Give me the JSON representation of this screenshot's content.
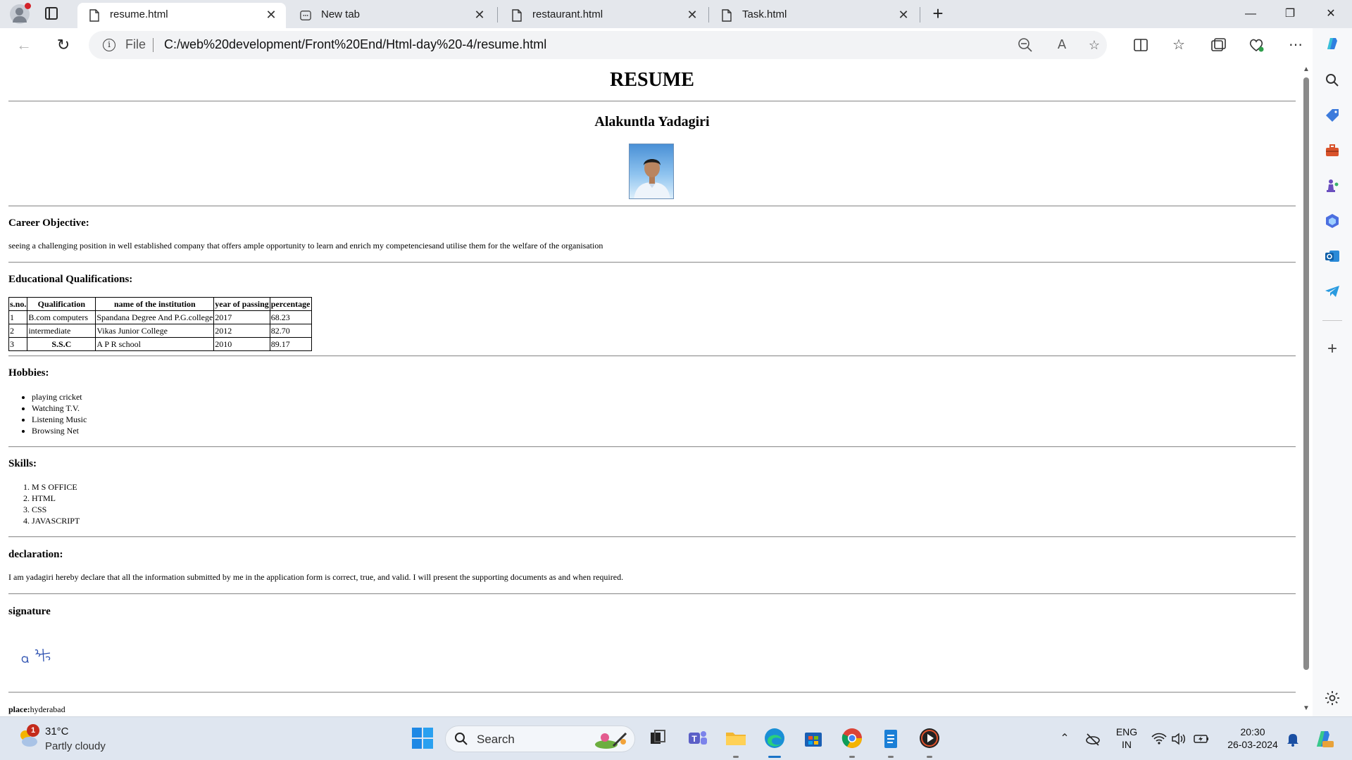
{
  "browser": {
    "tabs": [
      {
        "title": "resume.html",
        "active": true
      },
      {
        "title": "New tab",
        "active": false
      },
      {
        "title": "restaurant.html",
        "active": false
      },
      {
        "title": "Task.html",
        "active": false
      }
    ],
    "window_controls": {
      "minimize": "—",
      "restore": "❐",
      "close": "✕"
    },
    "address": {
      "scheme_label": "File",
      "url": "C:/web%20development/Front%20End/Html-day%20-4/resume.html"
    }
  },
  "page": {
    "title": "RESUME",
    "name": "Alakuntla Yadagiri",
    "career": {
      "heading": "Career Objective:",
      "text": "seeing a challenging position in well established company that offers ample opportunity to learn and enrich my competenciesand utilise them for the welfare of the organisation"
    },
    "education": {
      "heading": "Educational Qualifications:",
      "columns": [
        "s.no.",
        "Qualification",
        "name of the institution",
        "year of passing",
        "percentage"
      ],
      "rows": [
        [
          "1",
          "B.com computers",
          "Spandana Degree And P.G.college",
          "2017",
          "68.23"
        ],
        [
          "2",
          "intermediate",
          "Vikas Junior College",
          "2012",
          "82.70"
        ],
        [
          "3",
          "S.S.C",
          "A P R school",
          "2010",
          "89.17"
        ]
      ]
    },
    "hobbies": {
      "heading": "Hobbies:",
      "items": [
        "playing cricket",
        "Watching T.V.",
        "Listening Music",
        "Browsing Net"
      ]
    },
    "skills": {
      "heading": "Skills:",
      "items": [
        "M S OFFICE",
        "HTML",
        "CSS",
        "JAVASCRIPT"
      ]
    },
    "declaration": {
      "heading": "declaration:",
      "text": "I am yadagiri hereby declare that all the information submitted by me in the application form is correct, true, and valid. I will present the supporting documents as and when required."
    },
    "signature": {
      "heading": "signature",
      "image_text": "a y"
    },
    "place": {
      "label": "place:",
      "value": "hyderabad"
    }
  },
  "taskbar": {
    "weather": {
      "temp": "31°C",
      "desc": "Partly cloudy",
      "badge": "1"
    },
    "search_label": "Search",
    "language": {
      "line1": "ENG",
      "line2": "IN"
    },
    "clock": {
      "time": "20:30",
      "date": "26-03-2024"
    }
  },
  "colors": {
    "accent": "#0f6cbd",
    "tab_bar": "#e4e7ec",
    "taskbar": "#dfe6f0"
  }
}
